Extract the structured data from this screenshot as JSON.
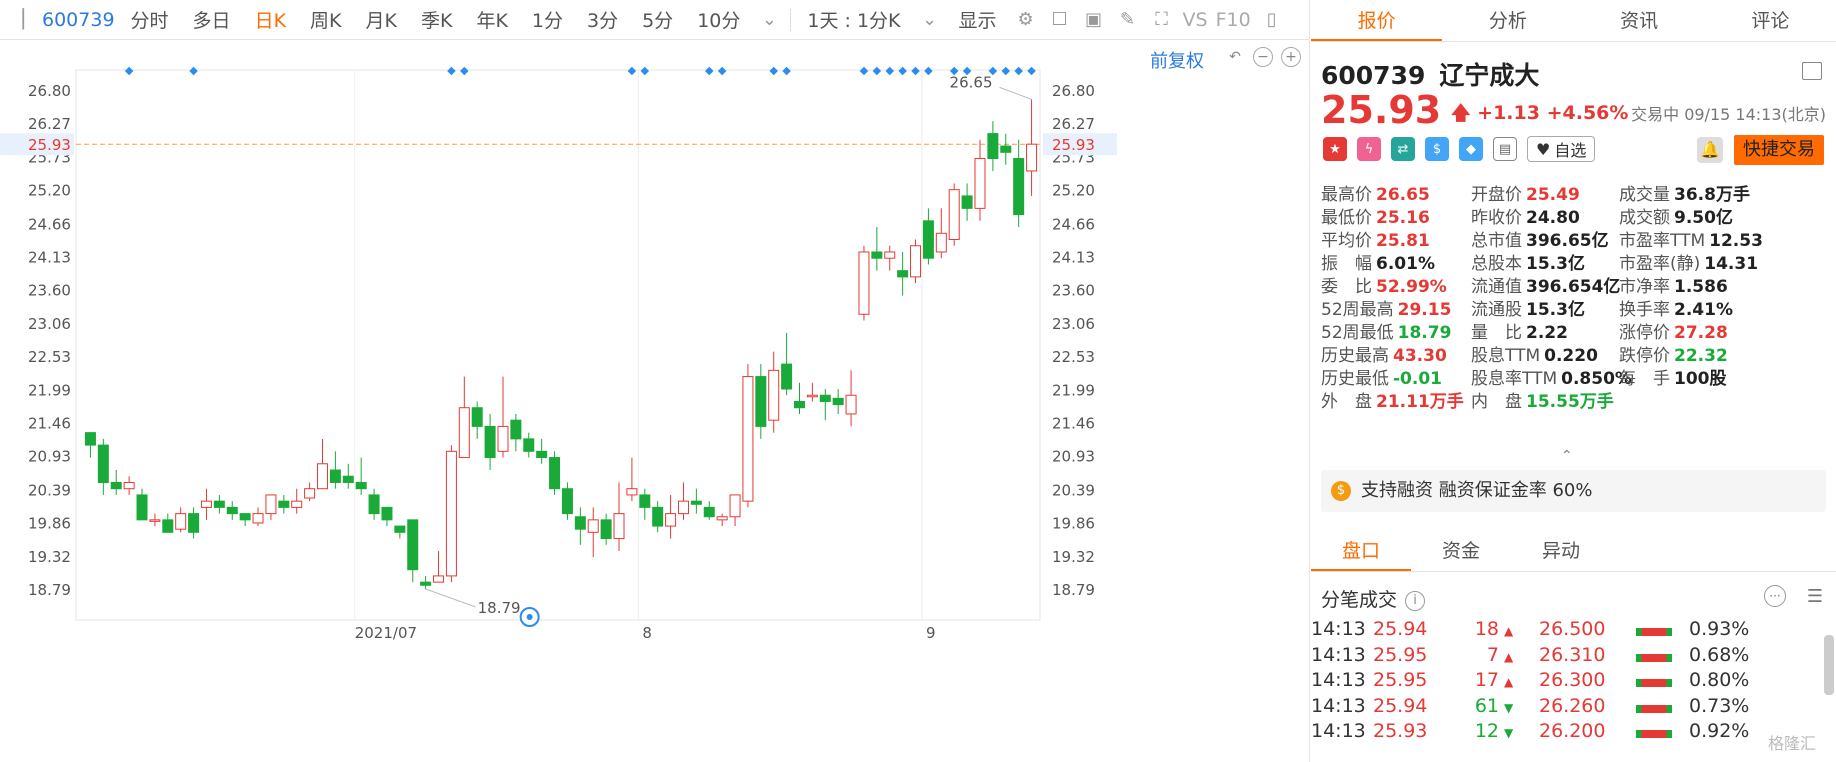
{
  "toolbar": {
    "code": "600739",
    "tabs": [
      "分时",
      "多日",
      "日K",
      "周K",
      "月K",
      "季K",
      "年K",
      "1分",
      "3分",
      "5分",
      "10分"
    ],
    "active_tab": "日K",
    "combo": "1天 : 1分K",
    "display": "显示",
    "vs": "VS",
    "f10": "F10"
  },
  "chart_ctrl": {
    "qfq": "前复权"
  },
  "chart_data": {
    "type": "candlestick",
    "y_ticks": [
      "26.80",
      "26.27",
      "25.73",
      "25.20",
      "24.66",
      "24.13",
      "23.60",
      "23.06",
      "22.53",
      "21.99",
      "21.46",
      "20.93",
      "20.39",
      "19.86",
      "19.32",
      "18.79"
    ],
    "x_labels": [
      "2021/07",
      "8",
      "9"
    ],
    "current_price_label": "25.93",
    "high_annotation": "26.65",
    "low_annotation": "18.79",
    "candles": [
      [
        21.3,
        21.1,
        21.3,
        20.9
      ],
      [
        21.1,
        20.5,
        21.2,
        20.3
      ],
      [
        20.5,
        20.4,
        20.7,
        20.3
      ],
      [
        20.4,
        20.5,
        20.6,
        20.3
      ],
      [
        20.3,
        19.9,
        20.4,
        19.9
      ],
      [
        19.9,
        19.9,
        20.0,
        19.8
      ],
      [
        19.9,
        19.7,
        20.0,
        19.7
      ],
      [
        19.75,
        20.0,
        20.1,
        19.7
      ],
      [
        20.0,
        19.7,
        20.1,
        19.6
      ],
      [
        20.1,
        20.2,
        20.4,
        19.9
      ],
      [
        20.2,
        20.1,
        20.3,
        20.0
      ],
      [
        20.1,
        20.0,
        20.2,
        19.9
      ],
      [
        20.0,
        19.9,
        20.0,
        19.8
      ],
      [
        19.85,
        20.0,
        20.1,
        19.8
      ],
      [
        20.0,
        20.3,
        20.3,
        19.9
      ],
      [
        20.2,
        20.1,
        20.3,
        20.0
      ],
      [
        20.1,
        20.2,
        20.4,
        20.0
      ],
      [
        20.25,
        20.4,
        20.5,
        20.2
      ],
      [
        20.4,
        20.8,
        21.2,
        20.4
      ],
      [
        20.7,
        20.5,
        21.0,
        20.4
      ],
      [
        20.6,
        20.5,
        20.8,
        20.4
      ],
      [
        20.5,
        20.4,
        20.9,
        20.3
      ],
      [
        20.3,
        20.0,
        20.4,
        19.9
      ],
      [
        20.1,
        19.9,
        20.1,
        19.8
      ],
      [
        19.8,
        19.7,
        19.8,
        19.6
      ],
      [
        19.9,
        19.1,
        19.9,
        18.9
      ],
      [
        18.9,
        18.85,
        19.0,
        18.79
      ],
      [
        18.9,
        19.0,
        19.4,
        18.9
      ],
      [
        19.0,
        21.0,
        21.1,
        18.9
      ],
      [
        20.9,
        21.7,
        22.2,
        20.9
      ],
      [
        21.7,
        21.4,
        21.8,
        21.2
      ],
      [
        21.4,
        20.9,
        21.6,
        20.7
      ],
      [
        21.0,
        21.4,
        22.2,
        20.9
      ],
      [
        21.5,
        21.2,
        21.6,
        21.0
      ],
      [
        21.2,
        21.0,
        21.3,
        20.9
      ],
      [
        21.0,
        20.9,
        21.2,
        20.8
      ],
      [
        20.9,
        20.4,
        21.0,
        20.3
      ],
      [
        20.4,
        20.0,
        20.5,
        19.9
      ],
      [
        19.95,
        19.75,
        20.1,
        19.5
      ],
      [
        19.7,
        19.9,
        20.1,
        19.3
      ],
      [
        19.9,
        19.6,
        20.0,
        19.5
      ],
      [
        19.6,
        20.0,
        20.5,
        19.4
      ],
      [
        20.3,
        20.4,
        20.9,
        20.2
      ],
      [
        20.3,
        20.1,
        20.4,
        19.9
      ],
      [
        20.1,
        19.8,
        20.2,
        19.7
      ],
      [
        19.8,
        20.0,
        20.3,
        19.6
      ],
      [
        20.0,
        20.2,
        20.5,
        19.9
      ],
      [
        20.2,
        20.15,
        20.4,
        20.0
      ],
      [
        20.1,
        19.95,
        20.2,
        19.9
      ],
      [
        19.9,
        19.95,
        20.0,
        19.8
      ],
      [
        19.95,
        20.3,
        20.3,
        19.8
      ],
      [
        20.2,
        22.2,
        22.4,
        20.1
      ],
      [
        22.2,
        21.4,
        22.4,
        21.2
      ],
      [
        21.5,
        22.3,
        22.6,
        21.3
      ],
      [
        22.4,
        22.0,
        22.9,
        21.9
      ],
      [
        21.8,
        21.7,
        22.1,
        21.6
      ],
      [
        21.9,
        21.9,
        22.1,
        21.8
      ],
      [
        21.9,
        21.8,
        22.0,
        21.5
      ],
      [
        21.85,
        21.75,
        22.0,
        21.6
      ],
      [
        21.6,
        21.9,
        22.3,
        21.4
      ],
      [
        23.2,
        24.2,
        24.3,
        23.1
      ],
      [
        24.2,
        24.1,
        24.6,
        23.9
      ],
      [
        24.1,
        24.2,
        24.3,
        23.9
      ],
      [
        23.9,
        23.8,
        24.2,
        23.5
      ],
      [
        23.8,
        24.3,
        24.4,
        23.7
      ],
      [
        24.7,
        24.1,
        24.9,
        24.0
      ],
      [
        24.2,
        24.5,
        24.9,
        24.1
      ],
      [
        24.4,
        25.2,
        25.3,
        24.3
      ],
      [
        25.1,
        24.9,
        25.3,
        24.7
      ],
      [
        24.9,
        25.7,
        26.0,
        24.7
      ],
      [
        26.1,
        25.7,
        26.3,
        25.5
      ],
      [
        25.9,
        25.8,
        26.1,
        25.6
      ],
      [
        25.7,
        24.8,
        26.0,
        24.6
      ],
      [
        25.5,
        25.93,
        26.65,
        25.1
      ]
    ],
    "marker_slots": [
      3,
      8,
      28,
      29,
      42,
      43,
      48,
      49,
      53,
      54,
      60,
      61,
      62,
      63,
      64,
      65,
      67,
      68,
      70,
      71,
      72,
      73
    ]
  },
  "quote": {
    "code": "600739",
    "name": "辽宁成大",
    "price": "25.93",
    "change": "+1.13 +4.56%",
    "status": "交易中 09/15 14:13(北京)",
    "zixuan": "自选",
    "trade_button": "快捷交易",
    "margin_text": "支持融资 融资保证金率 60%"
  },
  "tabs": [
    "报价",
    "分析",
    "资讯",
    "评论"
  ],
  "active_tab": "报价",
  "stats": [
    [
      {
        "k": "最高价",
        "v": "26.65",
        "c": "red"
      },
      {
        "k": "开盘价",
        "v": "25.49",
        "c": "red"
      },
      {
        "k": "成交量",
        "v": "36.8万手",
        "c": ""
      }
    ],
    [
      {
        "k": "最低价",
        "v": "25.16",
        "c": "red"
      },
      {
        "k": "昨收价",
        "v": "24.80",
        "c": ""
      },
      {
        "k": "成交额",
        "v": "9.50亿",
        "c": ""
      }
    ],
    [
      {
        "k": "平均价",
        "v": "25.81",
        "c": "red"
      },
      {
        "k": "总市值",
        "v": "396.65亿",
        "c": ""
      },
      {
        "k": "市盈率TTM",
        "v": "12.53",
        "c": ""
      }
    ],
    [
      {
        "k": "振　幅",
        "v": "6.01%",
        "c": ""
      },
      {
        "k": "总股本",
        "v": "15.3亿",
        "c": ""
      },
      {
        "k": "市盈率(静)",
        "v": "14.31",
        "c": ""
      }
    ],
    [
      {
        "k": "委　比",
        "v": "52.99%",
        "c": "red"
      },
      {
        "k": "流通值",
        "v": "396.654亿",
        "c": ""
      },
      {
        "k": "市净率",
        "v": "1.586",
        "c": ""
      }
    ],
    [
      {
        "k": "52周最高",
        "v": "29.15",
        "c": "red"
      },
      {
        "k": "流通股",
        "v": "15.3亿",
        "c": ""
      },
      {
        "k": "换手率",
        "v": "2.41%",
        "c": ""
      }
    ],
    [
      {
        "k": "52周最低",
        "v": "18.79",
        "c": "green"
      },
      {
        "k": "量　比",
        "v": "2.22",
        "c": ""
      },
      {
        "k": "涨停价",
        "v": "27.28",
        "c": "red"
      }
    ],
    [
      {
        "k": "历史最高",
        "v": "43.30",
        "c": "red"
      },
      {
        "k": "股息TTM",
        "v": "0.220",
        "c": ""
      },
      {
        "k": "跌停价",
        "v": "22.32",
        "c": "green"
      }
    ],
    [
      {
        "k": "历史最低",
        "v": "-0.01",
        "c": "green"
      },
      {
        "k": "股息率TTM",
        "v": "0.850%",
        "c": ""
      },
      {
        "k": "每　手",
        "v": "100股",
        "c": ""
      }
    ],
    [
      {
        "k": "外　盘",
        "v": "21.11万手",
        "c": "red"
      },
      {
        "k": "内　盘",
        "v": "15.55万手",
        "c": "green"
      },
      {
        "k": "",
        "v": "",
        "c": ""
      }
    ]
  ],
  "subtabs": [
    "盘口",
    "资金",
    "异动"
  ],
  "active_subtab": "盘口",
  "fenbi_title": "分笔成交",
  "fenbi": [
    {
      "time": "14:13",
      "price": "25.94",
      "vol": "18",
      "dir": "up",
      "val": "26.500",
      "pct": "0.93%"
    },
    {
      "time": "14:13",
      "price": "25.95",
      "vol": "7",
      "dir": "up",
      "val": "26.310",
      "pct": "0.68%"
    },
    {
      "time": "14:13",
      "price": "25.95",
      "vol": "17",
      "dir": "up",
      "val": "26.300",
      "pct": "0.80%"
    },
    {
      "time": "14:13",
      "price": "25.94",
      "vol": "61",
      "dir": "down",
      "val": "26.260",
      "pct": "0.73%"
    },
    {
      "time": "14:13",
      "price": "25.93",
      "vol": "12",
      "dir": "down",
      "val": "26.200",
      "pct": "0.92%"
    }
  ],
  "watermark": "格隆汇",
  "colors": {
    "up": "#e53935",
    "down": "#1aaa39",
    "accent": "#ff6b00",
    "link": "#2a7ae2"
  }
}
